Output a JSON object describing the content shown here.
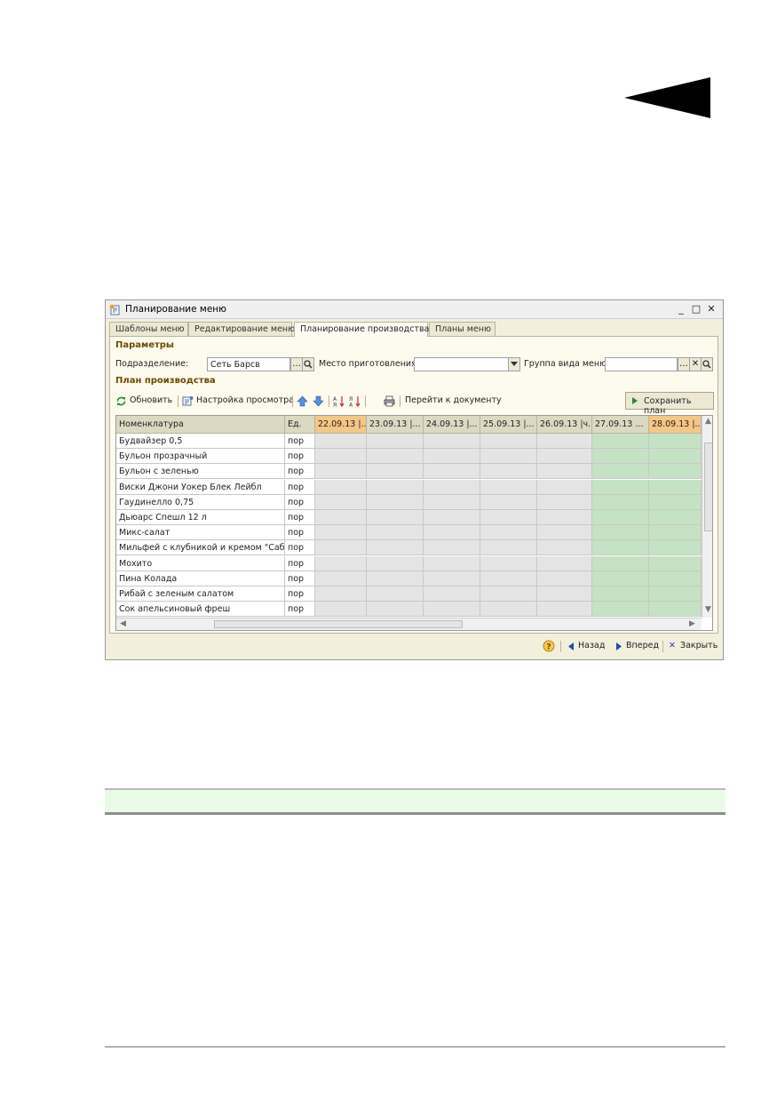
{
  "window": {
    "title": "Планирование меню",
    "controls": [
      "_",
      "□",
      "✕"
    ]
  },
  "tabs": [
    {
      "label": "Шаблоны меню",
      "active": false
    },
    {
      "label": "Редактирование меню",
      "active": false
    },
    {
      "label": "Планирование производства",
      "active": true
    },
    {
      "label": "Планы меню",
      "active": false
    }
  ],
  "params": {
    "title": "Параметры",
    "division_label": "Подразделение:",
    "division_value": "Сеть Барсв",
    "place_label": "Место приготовления:",
    "place_value": "",
    "group_label": "Группа вида меню:",
    "group_value": ""
  },
  "plan": {
    "title": "План производства",
    "refresh": "Обновить",
    "view_settings": "Настройка просмотра",
    "go_to_document": "Перейти к документу",
    "save_plan": "Сохранить план"
  },
  "table": {
    "headers": [
      "Номенклатура",
      "Ед.",
      "22.09.13 |...",
      "23.09.13 |...",
      "24.09.13 |...",
      "25.09.13 |...",
      "26.09.13 |ч...",
      "27.09.13 ...",
      "28.09.13 |..."
    ],
    "rows": [
      [
        "Будвайзер 0,5",
        "пор"
      ],
      [
        "Бульон прозрачный",
        "пор"
      ],
      [
        "Бульон с зеленью",
        "пор"
      ],
      [
        "Виски Джони Уокер Блек Лейбл",
        "пор"
      ],
      [
        "Гаудинелло 0,75",
        "пор"
      ],
      [
        "Дьюарс Спешл 12 л",
        "пор"
      ],
      [
        "Микс-салат",
        "пор"
      ],
      [
        "Мильфей с клубникой и кремом \"Саб...",
        "пор"
      ],
      [
        "Мохито",
        "пор"
      ],
      [
        "Пина Колада",
        "пор"
      ],
      [
        "Рибай с зеленым салатом",
        "пор"
      ],
      [
        "Сок апельсиновый фреш",
        "пор"
      ]
    ]
  },
  "statusbar": {
    "help": "?",
    "back": "Назад",
    "forward": "Вперед",
    "close": "Закрыть"
  },
  "colors": {
    "weekend_header": "#f4c784",
    "weekend_cell": "#c6e2c4",
    "weekday_cell": "#e4e4e4",
    "section_title": "#6b4a00"
  }
}
